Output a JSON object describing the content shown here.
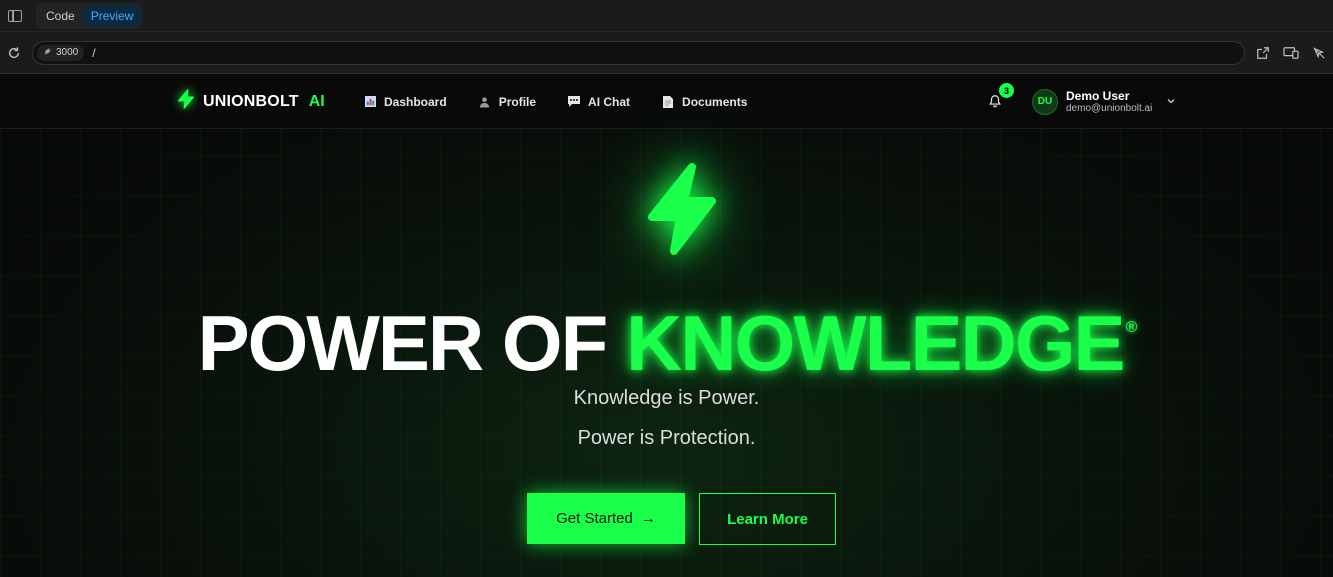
{
  "editor": {
    "tabs": [
      {
        "label": "Code",
        "active": false
      },
      {
        "label": "Preview",
        "active": true
      }
    ]
  },
  "address": {
    "port": "3000",
    "path": "/"
  },
  "nav": {
    "brand": "UNIONBOLT",
    "brand_accent": "AI",
    "items": [
      {
        "label": "Dashboard",
        "icon": "chart-icon"
      },
      {
        "label": "Profile",
        "icon": "user-icon"
      },
      {
        "label": "AI Chat",
        "icon": "chat-icon"
      },
      {
        "label": "Documents",
        "icon": "document-icon"
      }
    ],
    "notifications_count": "3",
    "user": {
      "initials": "DU",
      "name": "Demo User",
      "email": "demo@unionbolt.ai"
    }
  },
  "hero": {
    "headline_white": "POWER OF",
    "headline_green": "KNOWLEDGE",
    "registered": "®",
    "line1": "Knowledge is Power.",
    "line2": "Power is Protection.",
    "cta_primary": "Get Started",
    "cta_primary_arrow": "→",
    "cta_secondary": "Learn More"
  },
  "colors": {
    "accent": "#19ff4a",
    "background": "#0b0b0b",
    "preview_tab": "#4aa8ff"
  }
}
